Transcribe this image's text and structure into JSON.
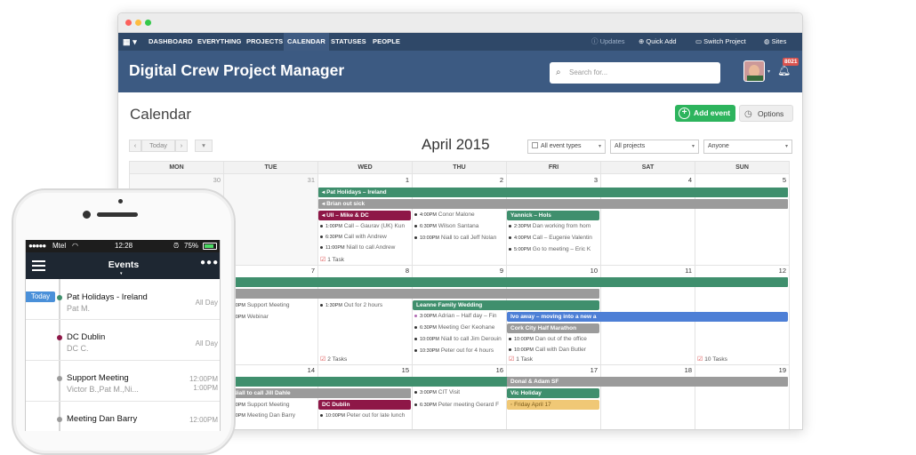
{
  "colors": {
    "nav": "#2f4868",
    "header": "#3c5a82",
    "green": "#3f8f6d",
    "gray": "#9b9b9b",
    "maroon": "#8e1747",
    "blue": "#4d7fd6",
    "yellow": "#f0c876",
    "btn_green": "#2db45d"
  },
  "topnav": {
    "items": [
      "DASHBOARD",
      "EVERYTHING",
      "PROJECTS",
      "CALENDAR",
      "STATUSES",
      "PEOPLE"
    ],
    "active": "CALENDAR",
    "updates": "Updates",
    "quick_add": "Quick Add",
    "switch_project": "Switch Project",
    "sites": "Sites"
  },
  "header": {
    "title": "Digital Crew Project Manager",
    "search_placeholder": "Search for...",
    "badge": "8021"
  },
  "page": {
    "title": "Calendar",
    "add_event": "Add event",
    "options": "Options",
    "today": "Today",
    "month": "April 2015",
    "filters": {
      "event_types": "All event types",
      "projects": "All projects",
      "people": "Anyone"
    }
  },
  "calendar": {
    "days": [
      "MON",
      "TUE",
      "WED",
      "THU",
      "FRI",
      "SAT",
      "SUN"
    ],
    "week1": [
      "30",
      "31",
      "1",
      "2",
      "3",
      "4",
      "5"
    ],
    "week2": [
      "6",
      "7",
      "8",
      "9",
      "10",
      "11",
      "12"
    ],
    "week3": [
      "13",
      "14",
      "15",
      "16",
      "17",
      "18",
      "19"
    ],
    "bars": {
      "pat": "Pat Holidays – Ireland",
      "brian": "Brian out sick",
      "ull": "Ull – Mike & DC",
      "yannick": "Yannick – Hols",
      "leanne": "Leanne Family Wedding",
      "ivo": "Ivo away – moving into a new a",
      "cork": "Cork City Half Marathon",
      "niall": "Niall to call Jill Dahle",
      "donal": "Donal & Adam SF",
      "dcdublin": "DC Dublin",
      "vic": "Vic Holiday",
      "friday": "Friday April 17"
    },
    "events": {
      "w1wed1": {
        "t": "1:00PM",
        "x": "Call – Gaurav (UK) Kun"
      },
      "w1wed2": {
        "t": "6:30PM",
        "x": "Call with Andrew"
      },
      "w1wed3": {
        "t": "11:00PM",
        "x": "Niall to call Andrew"
      },
      "w1thu1": {
        "t": "4:00PM",
        "x": "Conor Malone"
      },
      "w1thu2": {
        "t": "6:30PM",
        "x": "Wilson Santana"
      },
      "w1thu3": {
        "t": "10:00PM",
        "x": "Niall to call Jeff Nolan"
      },
      "w1fri1": {
        "t": "2:30PM",
        "x": "Dan working from hom"
      },
      "w1fri2": {
        "t": "4:00PM",
        "x": "Call – Eugenie Valentin"
      },
      "w1fri3": {
        "t": "5:00PM",
        "x": "Go to meeting – Eric K"
      },
      "w2tue1": {
        "t": "10:00PM",
        "x": "Support Meeting"
      },
      "w2tue2": {
        "t": "10:00PM",
        "x": "Webinar"
      },
      "w2wed1": {
        "t": "1:30PM",
        "x": "Out for 2 hours"
      },
      "w2thu1": {
        "t": "3:00PM",
        "x": "Adrian – Half day – Fin"
      },
      "w2thu2": {
        "t": "6:30PM",
        "x": "Meeting Ger Keohane"
      },
      "w2thu3": {
        "t": "10:00PM",
        "x": "Niall to call Jim Derouin"
      },
      "w2thu4": {
        "t": "10:30PM",
        "x": "Peter out for 4 hours"
      },
      "w2fri1": {
        "t": "10:00PM",
        "x": "Dan out of the office"
      },
      "w2fri2": {
        "t": "10:00PM",
        "x": "Call with Dan Butler"
      },
      "w3tue1": {
        "t": "10:00PM",
        "x": "Support Meeting"
      },
      "w3tue2": {
        "t": "10:00PM",
        "x": "Meeting Dan Barry"
      },
      "w3wed1": {
        "t": "10:00PM",
        "x": "Peter out for late lunch"
      },
      "w3thu1": {
        "t": "3:00PM",
        "x": "CIT Visit"
      },
      "w3thu2": {
        "t": "6:30PM",
        "x": "Peter meeting Gerard F"
      }
    },
    "tasks": {
      "w1wed": "1 Task",
      "w2wed": "2 Tasks",
      "w2fri": "1 Task",
      "w2sun": "10 Tasks"
    }
  },
  "phone": {
    "carrier": "Mtel",
    "time": "12:28",
    "battery": "75%",
    "title": "Events",
    "today": "Today",
    "rows": [
      {
        "title": "Pat Holidays - Ireland",
        "sub": "Pat M.",
        "time": "All Day"
      },
      {
        "title": "DC Dublin",
        "sub": "DC C.",
        "time": "All Day"
      },
      {
        "title": "Support Meeting",
        "sub": "Victor B.,Pat M.,Ni...",
        "time1": "12:00PM",
        "time2": "1:00PM"
      },
      {
        "title": "Meeting Dan Barry",
        "sub": "",
        "time1": "12:00PM",
        "time2": ""
      }
    ]
  }
}
